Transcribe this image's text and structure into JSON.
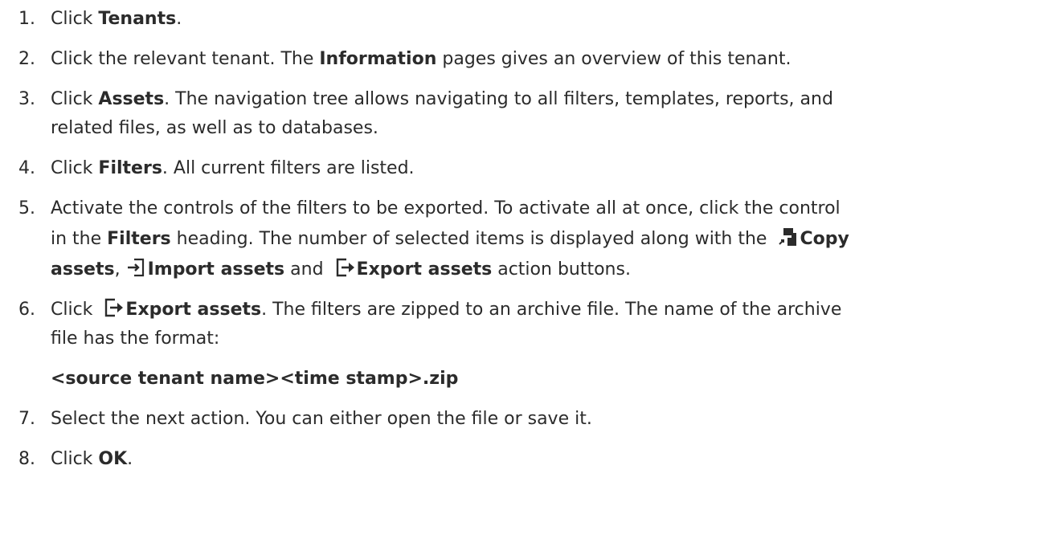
{
  "steps": [
    {
      "num": "1.",
      "pre": "Click ",
      "b1": "Tenants",
      "post": "."
    },
    {
      "num": "2.",
      "pre": "Click the relevant tenant. The ",
      "b1": "Information",
      "post": " pages gives an overview of this tenant."
    },
    {
      "num": "3.",
      "pre": "Click ",
      "b1": "Assets",
      "post": ". The navigation tree allows navigating to all filters, templates, reports, and",
      "line2": "related files, as well as to databases."
    },
    {
      "num": "4.",
      "pre": "Click ",
      "b1": "Filters",
      "post": ". All current filters are listed."
    },
    {
      "num": "5.",
      "line1": "Activate the controls of the filters to be exported. To activate all at once, click the control",
      "l2_pre": "in the ",
      "l2_b": "Filters",
      "l2_mid": " heading. The number of selected items is displayed along with the ",
      "copy_b1": "Copy",
      "copy_b2": "assets",
      "comma": ",",
      "import_b": "Import assets",
      "and": " and ",
      "export_b": "Export assets",
      "tail": " action buttons."
    },
    {
      "num": "6.",
      "pre": "Click ",
      "export_b": "Export assets",
      "post": ". The filters are zipped to an archive file. The name of the archive",
      "line2": "file has the format:",
      "code": "<source tenant name><time stamp>.zip"
    },
    {
      "num": "7.",
      "text": "Select the next action. You can either open the file or save it."
    },
    {
      "num": "8.",
      "pre": "Click ",
      "b1": "OK",
      "post": "."
    }
  ],
  "icons": {
    "copy": "copy-assets-icon",
    "import": "import-assets-icon",
    "export": "export-assets-icon"
  }
}
